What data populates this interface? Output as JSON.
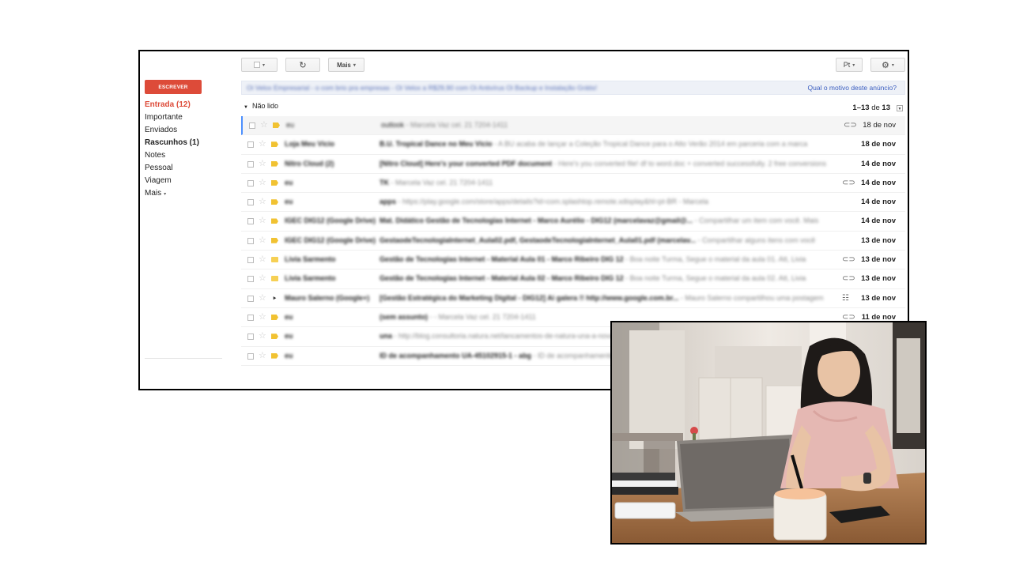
{
  "toolbar": {
    "select_caret": "▾",
    "refresh_glyph": "↻",
    "more_label": "Mais",
    "lang_label": "Pt",
    "settings_glyph": "⚙"
  },
  "sidebar": {
    "compose_label": "ESCREVER",
    "items": [
      {
        "label": "Entrada (12)"
      },
      {
        "label": "Importante"
      },
      {
        "label": "Enviados"
      },
      {
        "label": "Rascunhos (1)"
      },
      {
        "label": "Notes"
      },
      {
        "label": "Pessoal"
      },
      {
        "label": "Viagem"
      },
      {
        "label": "Mais"
      }
    ]
  },
  "ad": {
    "text": "Oi Velox Empresarial - o com brio pra empresas - Oi Velox a R$29,90 com Oi Antivírus Oi Backup e Instalação Grátis!",
    "link": "Qual o motivo deste anúncio?"
  },
  "list_header": {
    "section_label": "Não lido",
    "pager_start": "1",
    "pager_end": "13",
    "pager_sep": "–",
    "pager_of": "de",
    "pager_total": "13"
  },
  "emails": [
    {
      "from": "eu",
      "subject": "outlook",
      "snippet": " - Marcela Vaz cel. 21 7204-1411",
      "date": "18 de nov",
      "attach": "⊂⊃",
      "imp": "yellow"
    },
    {
      "from": "Loja Meu Vício",
      "subject": "B.U. Tropical Dance no Meu Vício",
      "snippet": " - A BU acaba de lançar a Coleção Tropical Dance para o Alto Verão 2014 em parceria com a marca",
      "date": "18 de nov",
      "attach": "",
      "imp": "yellow"
    },
    {
      "from": "Nitro Cloud (2)",
      "subject": "[Nitro Cloud] Here's your converted PDF document",
      "snippet": " - Here's you converted file! df to word.doc + converted successfully. 2 free conversions",
      "date": "14 de nov",
      "attach": "",
      "imp": "yellow"
    },
    {
      "from": "eu",
      "subject": "TK",
      "snippet": " - Marcela Vaz cel. 21 7204-1411",
      "date": "14 de nov",
      "attach": "⊂⊃",
      "imp": "yellow"
    },
    {
      "from": "eu",
      "subject": "apps",
      "snippet": " - https://play.google.com/store/apps/details?id=com.splashtop.remote.xdisplay&hl=pt-BR - Marcela",
      "date": "14 de nov",
      "attach": "",
      "imp": "yellow"
    },
    {
      "from": "IGEC DIG12 (Google Drive)",
      "subject": "Mat. Didático Gestão de Tecnologias Internet - Marco Aurélio - DIG12 (marcelavaz@gmail@...",
      "snippet": " - Compartilhar um item com você. Mais",
      "date": "14 de nov",
      "attach": "",
      "imp": "yellow"
    },
    {
      "from": "IGEC DIG12 (Google Drive)",
      "subject": "GestaodeTecnologiaInternet_Aula02.pdf, GestaodeTecnologiaInternet_Aula01.pdf (marcelav...",
      "snippet": " - Compartilhar alguns itens com você",
      "date": "13 de nov",
      "attach": "",
      "imp": "yellow"
    },
    {
      "from": "Livia Sarmento",
      "subject": "Gestão de Tecnologias Internet - Material Aula 01 - Marco Ribeiro DIG 12",
      "snippet": " - Boa noite Turma, Segue o material da aula 01. Att, Livia",
      "date": "13 de nov",
      "attach": "⊂⊃",
      "imp": "folder"
    },
    {
      "from": "Livia Sarmento",
      "subject": "Gestão de Tecnologias Internet - Material Aula 02 - Marco Ribeiro DIG 12",
      "snippet": " - Boa noite Turma, Segue o material da aula 02. Att, Livia",
      "date": "13 de nov",
      "attach": "⊂⊃",
      "imp": "folder"
    },
    {
      "from": "Mauro Salerno (Google+)",
      "subject": "[Gestão Estratégica do Marketing Digital - DIG12] Ai galera !! http://www.google.com.br...",
      "snippet": " - Mauro Salerno compartilhou uma postagem",
      "date": "13 de nov",
      "attach": "☷",
      "imp": "dark"
    },
    {
      "from": "eu",
      "subject": "(sem assunto)",
      "snippet": " - - Marcela Vaz cel. 21 7204-1411",
      "date": "11 de nov",
      "attach": "⊂⊃",
      "imp": "yellow"
    },
    {
      "from": "eu",
      "subject": "una",
      "snippet": " - http://blog.consultoria.natura.net/lancamentos-de-natura-una-a-nova-linha",
      "date": "",
      "attach": "",
      "imp": "yellow"
    },
    {
      "from": "eu",
      "subject": "ID de acompanhamento UA-45102915-1 - abg",
      "snippet": " - ID de acompanhamento",
      "date": "",
      "attach": "",
      "imp": "yellow"
    }
  ],
  "colors": {
    "accent": "#dd4b39",
    "link": "#3b5ec0",
    "important": "#f1c232"
  }
}
